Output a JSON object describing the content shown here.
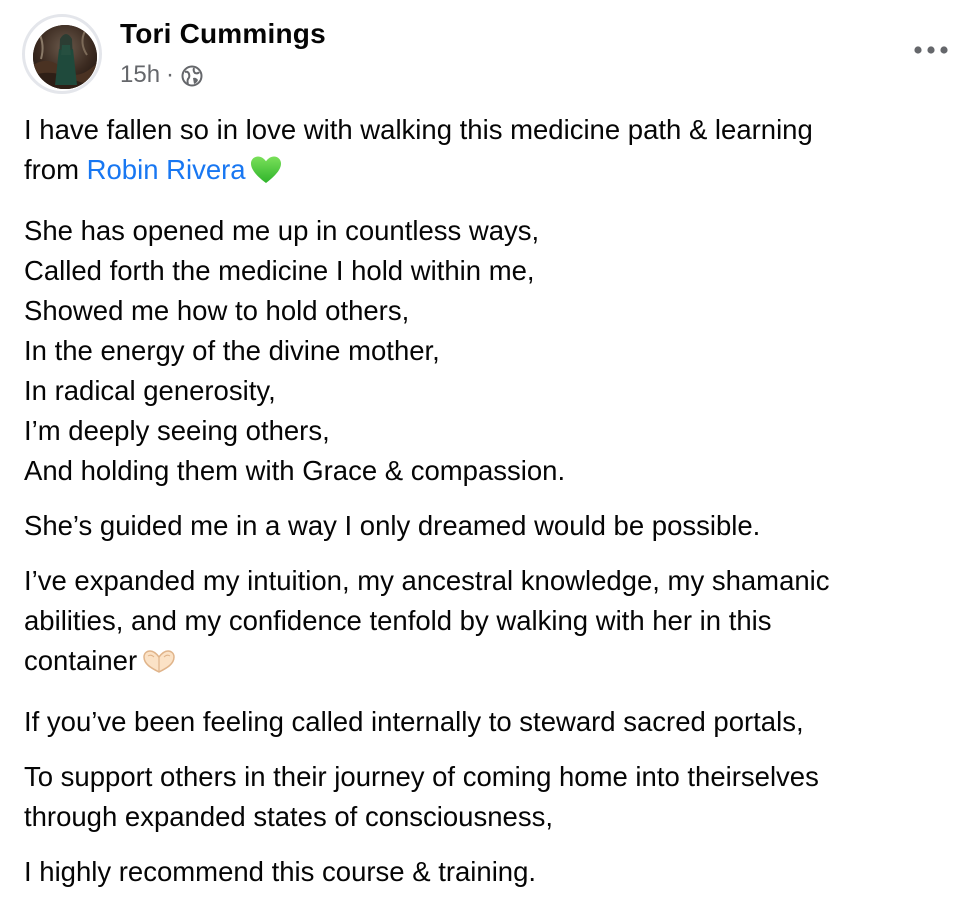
{
  "post": {
    "author": {
      "name": "Tori Cummings",
      "avatar_icon": "profile-photo"
    },
    "meta": {
      "time": "15h",
      "separator": "·",
      "audience_icon": "globe-icon"
    },
    "menu_icon": "more-options-icon",
    "body": {
      "p1": {
        "line1": "I have fallen so in love with walking this medicine path & learning",
        "line2_prefix": "from ",
        "mention": "Robin Rivera",
        "emoji": "green-heart"
      },
      "p2": [
        "She has opened me up in countless ways,",
        "Called forth the medicine I hold within me,",
        "Showed me how to hold others,",
        "In the energy of the divine mother,",
        "In radical generosity,",
        "I’m deeply seeing others,",
        "And holding them with Grace & compassion."
      ],
      "p3": "She’s guided me in a way I only dreamed would be possible.",
      "p4": {
        "line1": "I’ve expanded my intuition, my ancestral knowledge, my shamanic",
        "line2": "abilities, and my confidence tenfold by walking with her in this",
        "line3": "container",
        "emoji": "heart-hands"
      },
      "p5": "If you’ve been feeling called internally to steward sacred portals,",
      "p6": {
        "line1": "To support others in their journey of coming home into theirselves",
        "line2": "through expanded states of consciousness,"
      },
      "p7": "I highly recommend this course & training."
    }
  },
  "colors": {
    "text": "#050505",
    "secondary_text": "#65676b",
    "link": "#1877f2",
    "background": "#ffffff"
  }
}
